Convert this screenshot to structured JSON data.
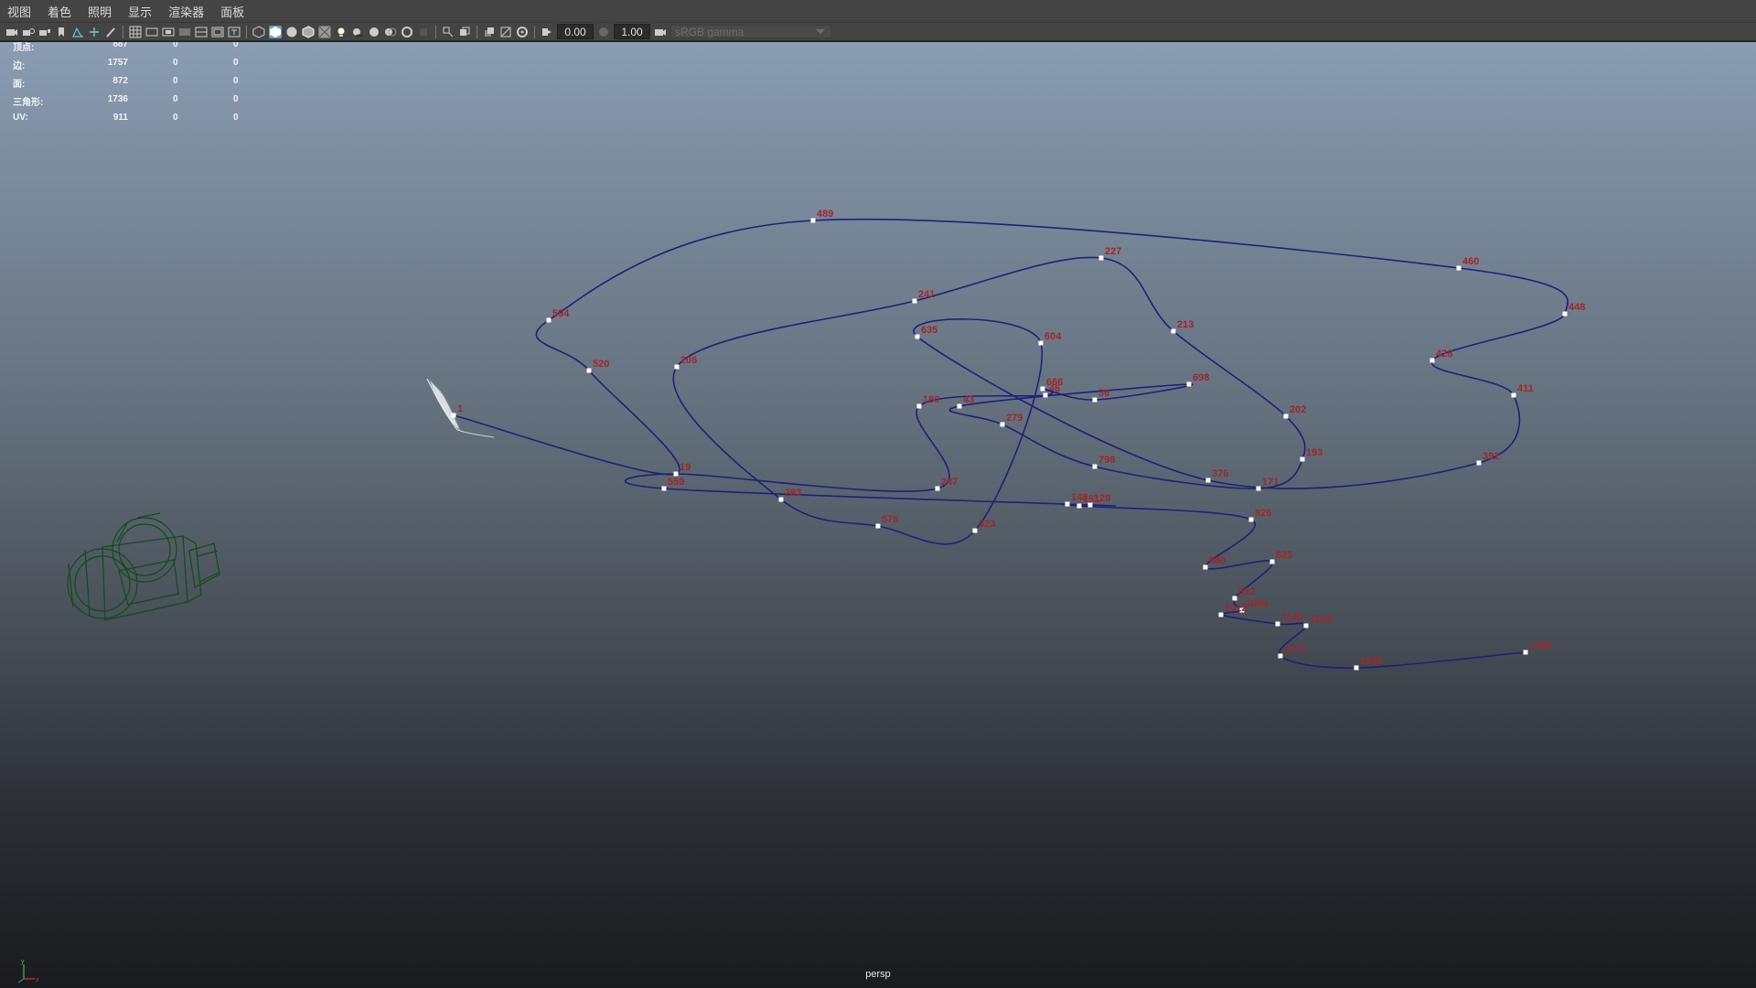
{
  "menubar": {
    "items": [
      "视图",
      "着色",
      "照明",
      "显示",
      "渲染器",
      "面板"
    ]
  },
  "toolbar": {
    "exposure": "0.00",
    "gamma": "1.00",
    "color_space": "sRGB gamma",
    "icons": [
      "camera-icon",
      "camera-attributes-icon",
      "camera-lock-icon",
      "bookmark-icon",
      "image-plane-icon",
      "2d-pan-zoom-icon",
      "grease-pencil-icon",
      "grid-icon",
      "film-gate-icon",
      "resolution-gate-icon",
      "gate-mask-icon",
      "field-chart-icon",
      "safe-action-icon",
      "safe-title-icon",
      "wireframe-icon",
      "smooth-shade-icon",
      "default-material-icon",
      "shaded-wireframe-icon",
      "textured-icon",
      "use-lights-icon",
      "shadows-icon",
      "screen-space-ao-icon",
      "motion-blur-icon",
      "anti-alias-icon",
      "depth-of-field-icon",
      "isolate-select-icon",
      "xray-icon",
      "xray-active-icon",
      "xray-joints-icon",
      "exposure-icon",
      "gamma-icon",
      "color-management-icon"
    ],
    "highlight_color": "#5fa0c7"
  },
  "hud": {
    "rows": [
      {
        "label": "顶点:",
        "v1": "887",
        "v2": "0",
        "v3": "0"
      },
      {
        "label": "边:",
        "v1": "1757",
        "v2": "0",
        "v3": "0"
      },
      {
        "label": "面:",
        "v1": "872",
        "v2": "0",
        "v3": "0"
      },
      {
        "label": "三角形:",
        "v1": "1736",
        "v2": "0",
        "v3": "0"
      },
      {
        "label": "UV:",
        "v1": "911",
        "v2": "0",
        "v3": "0"
      }
    ]
  },
  "viewport": {
    "camera_name": "persp",
    "curve_color": "#1f1f7a",
    "label_color": "#a0262a",
    "point_labels": [
      "1",
      "19",
      "559",
      "520",
      "594",
      "489",
      "227",
      "460",
      "448",
      "428",
      "411",
      "392",
      "213",
      "202",
      "193",
      "171",
      "376",
      "128",
      "241",
      "206",
      "293",
      "578",
      "323",
      "247",
      "604",
      "635",
      "666",
      "46",
      "36",
      "180",
      "43",
      "698",
      "279",
      "798",
      "148",
      "151",
      "826",
      "880",
      "825",
      "812",
      "1094",
      "1012",
      "1140",
      "1163",
      "1077",
      "1232",
      "1385"
    ],
    "camera_wire_color": "#0f4d14",
    "axis_labels": [
      "y",
      "x"
    ]
  }
}
